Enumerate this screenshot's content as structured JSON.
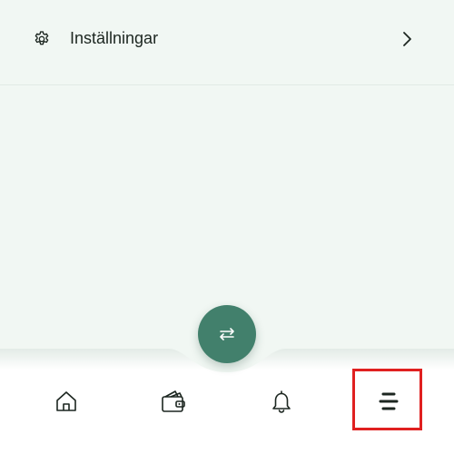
{
  "settings": {
    "label": "Inställningar",
    "icon": "gear-icon",
    "chevron": "chevron-right-icon"
  },
  "bottom_nav": {
    "fab_icon": "swap-arrows-icon",
    "items": [
      {
        "icon": "home-icon"
      },
      {
        "icon": "wallet-icon"
      },
      {
        "icon": "bell-icon"
      },
      {
        "icon": "menu-icon",
        "highlighted": true
      }
    ]
  },
  "colors": {
    "background": "#f1f7f3",
    "fab": "#42806c",
    "highlight": "#e02020",
    "text": "#1c2620"
  }
}
